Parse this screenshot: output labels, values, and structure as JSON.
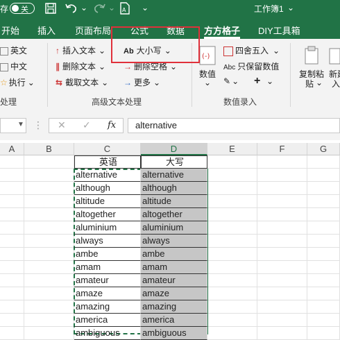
{
  "titlebar": {
    "autosave_label": "关",
    "filename": "工作簿1",
    "filename_arrow": "⌄"
  },
  "tabs": [
    "开始",
    "插入",
    "页面布局",
    "公式",
    "数据",
    "方方格子",
    "DIY工具箱"
  ],
  "ribbon": {
    "col1": [
      "英文",
      "中文",
      "执行"
    ],
    "col2": [
      "插入文本",
      "删除文本",
      "截取文本"
    ],
    "col3": [
      "大小写",
      "删除空格",
      "更多"
    ],
    "col4_value": "数值",
    "col5": [
      "四舍五入",
      "只保留数值"
    ],
    "col6": [
      "复制粘",
      "贴"
    ],
    "col7": [
      "新建",
      "入"
    ],
    "groups": [
      "处理",
      "高级文本处理",
      "数值录入"
    ],
    "abc_label": "Abc",
    "ab_label": "Ab",
    "plus": "+"
  },
  "formula_bar": {
    "value": "alternative",
    "fx": "fx"
  },
  "columns": [
    "A",
    "B",
    "C",
    "D",
    "E",
    "F",
    "G"
  ],
  "table": {
    "header_c": "英语",
    "header_d": "大写",
    "rows": [
      "alternative",
      "although",
      "altitude",
      "altogether",
      "aluminium",
      "always",
      "ambe",
      "amam",
      "amateur",
      "amaze",
      "amazing",
      "america",
      "ambiguous"
    ]
  },
  "colors": {
    "excel_green": "#217346",
    "highlight_red": "#e0303a",
    "selection_grey": "#c6c6c6"
  }
}
